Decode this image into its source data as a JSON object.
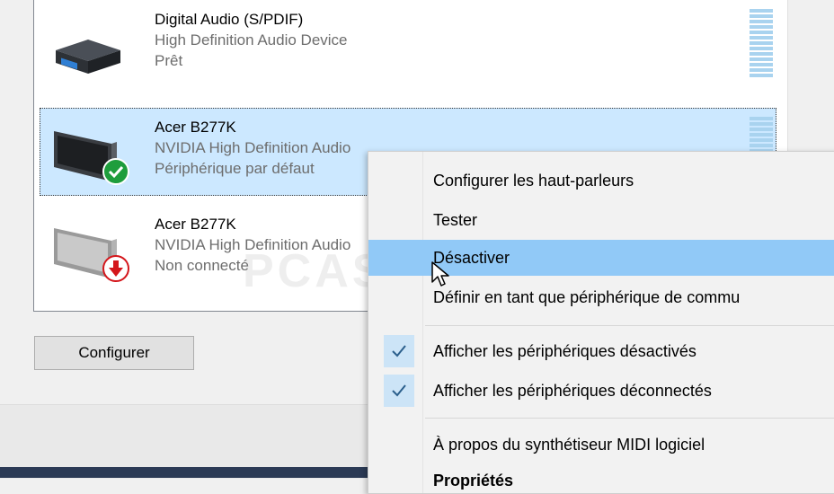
{
  "devices": [
    {
      "name": "Digital Audio (S/PDIF)",
      "driver": "High Definition Audio Device",
      "status": "Prêt",
      "icon": "digital-audio-device-icon"
    },
    {
      "name": "Acer B277K",
      "driver": "NVIDIA High Definition Audio",
      "status": "Périphérique par défaut",
      "icon": "monitor-icon",
      "badge": "default-check-icon",
      "selected": true
    },
    {
      "name": "Acer B277K",
      "driver": "NVIDIA High Definition Audio",
      "status": "Non connecté",
      "icon": "monitor-icon",
      "badge": "disconnected-arrow-icon"
    }
  ],
  "buttons": {
    "configure": "Configurer"
  },
  "context_menu": {
    "items": [
      {
        "label": "Configurer les haut-parleurs"
      },
      {
        "label": "Tester"
      },
      {
        "label": "Désactiver",
        "highlighted": true
      },
      {
        "label": "Définir en tant que périphérique de commu"
      },
      {
        "label": "Afficher les périphériques désactivés",
        "checked": true
      },
      {
        "label": "Afficher les périphériques déconnectés",
        "checked": true
      },
      {
        "label": "À propos du synthétiseur MIDI logiciel"
      },
      {
        "label": "Propriétés"
      }
    ]
  },
  "watermark": "PCASTUCES",
  "colors": {
    "selection": "#cce8ff",
    "menu_highlight": "#91c9f7",
    "check_bg": "#cce4f7",
    "status_ok": "#1e9d3c",
    "status_disconnected": "#d4161b"
  }
}
